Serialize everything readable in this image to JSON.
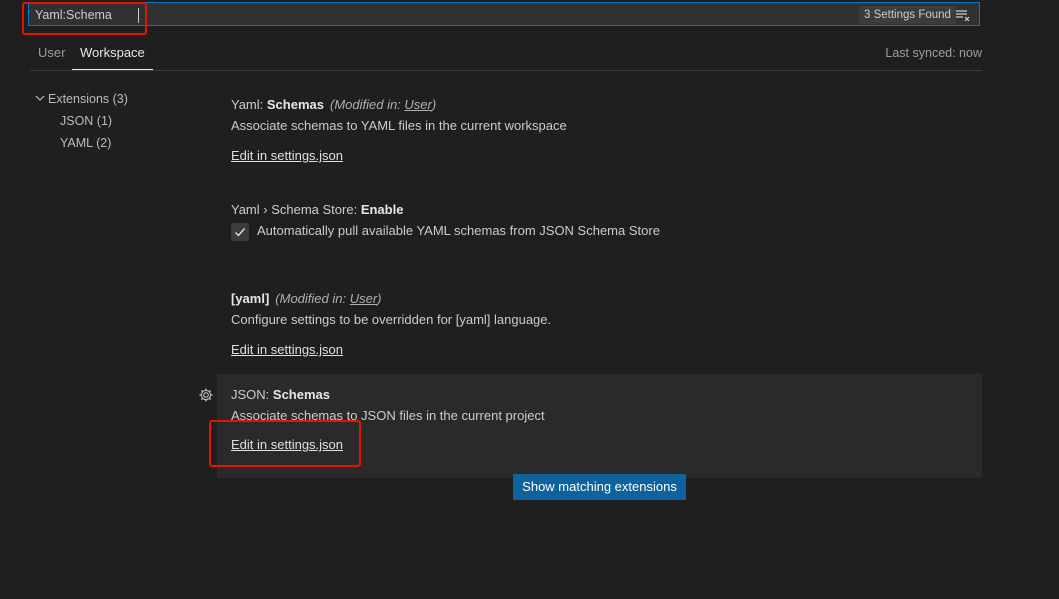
{
  "search": {
    "value": "Yaml:Schema",
    "count_label": "3 Settings Found"
  },
  "tabs": [
    {
      "label": "User"
    },
    {
      "label": "Workspace"
    }
  ],
  "last_synced": "Last synced: now",
  "toc": {
    "items": [
      {
        "label": "Extensions (3)"
      },
      {
        "label": "JSON (1)"
      },
      {
        "label": "YAML (2)"
      }
    ]
  },
  "settings": [
    {
      "category": "Yaml: ",
      "name": "Schemas",
      "modified_prefix": "(Modified in: ",
      "modified_link": "User",
      "modified_suffix": ")",
      "description": "Associate schemas to YAML files in the current workspace",
      "link": "Edit in settings.json"
    },
    {
      "category": "Yaml › Schema Store: ",
      "name": "Enable",
      "checkbox_label": "Automatically pull available YAML schemas from JSON Schema Store",
      "checked": true
    },
    {
      "category": "",
      "name": "[yaml]",
      "modified_prefix": "(Modified in: ",
      "modified_link": "User",
      "modified_suffix": ")",
      "description": "Configure settings to be overridden for [yaml] language.",
      "link": "Edit in settings.json"
    },
    {
      "category": "JSON: ",
      "name": "Schemas",
      "description": "Associate schemas to JSON files in the current project",
      "link": "Edit in settings.json"
    }
  ],
  "show_extensions_button": "Show matching extensions",
  "colors": {
    "background": "#1f1f1f",
    "accent": "#0078d4",
    "button": "#0e639c",
    "highlight_box": "#e51400"
  },
  "icons": [
    "clear-filter-icon",
    "chevron-down-icon",
    "check-icon",
    "gear-icon"
  ]
}
